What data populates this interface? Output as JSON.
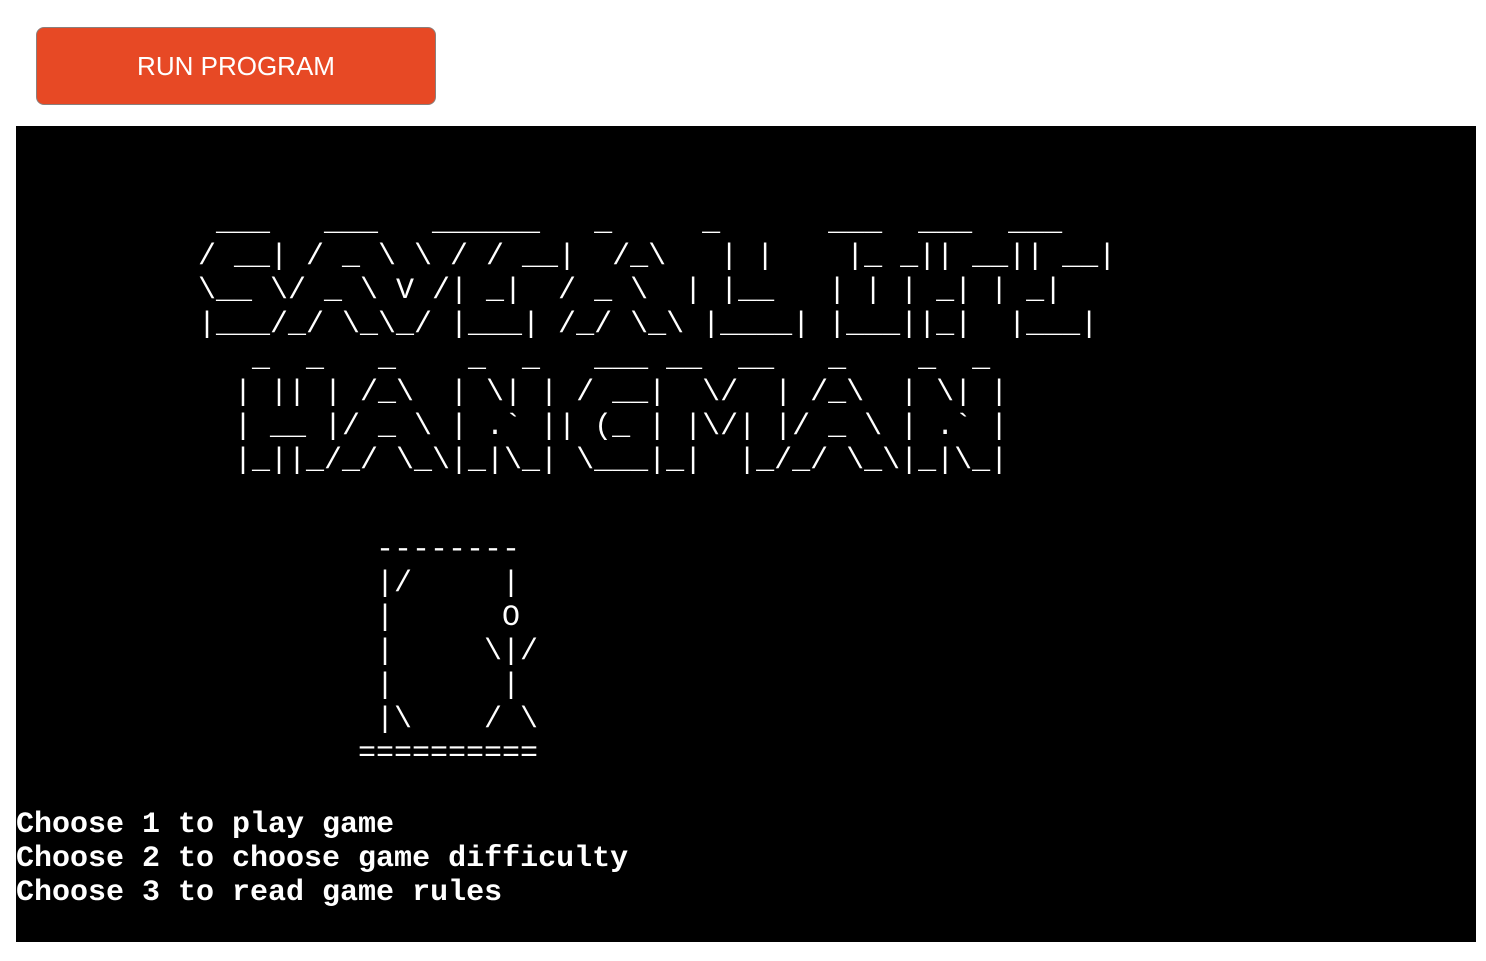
{
  "toolbar": {
    "run_label": "RUN PROGRAM",
    "run_color": "#e74925"
  },
  "terminal": {
    "background": "#000000",
    "title_art": "  ___   ___   ______   _     _      ___  ___  ___\n / __| / _ \\ \\ / / __|  /_\\   | |    |_ _|| __|| __|\n \\__ \\/ _ \\ V /| _|  / _ \\  | |__   | | | _| | _|\n |___/_/ \\_\\_/ |___| /_/ \\_\\ |____| |___||_|  |___|\n    _  _   _    _  _   ___ __  __   _    _  _\n   | || | /_\\  | \\| | / __|  \\/  | /_\\  | \\| |\n   | __ |/ _ \\ | .` || (_ | |\\/| |/ _ \\ | .` |\n   |_||_/_/ \\_\\|_|\\_| \\___|_|  |_/_/ \\_\\|_|\\_|",
    "gallows_art": "  --------\n  |/     |\n  |      O\n  |     \\|/\n  |      |\n  |\\    / \\\n ==========",
    "menu": [
      "Choose 1 to play game",
      "Choose 2 to choose game difficulty",
      "Choose 3 to read game rules"
    ]
  }
}
